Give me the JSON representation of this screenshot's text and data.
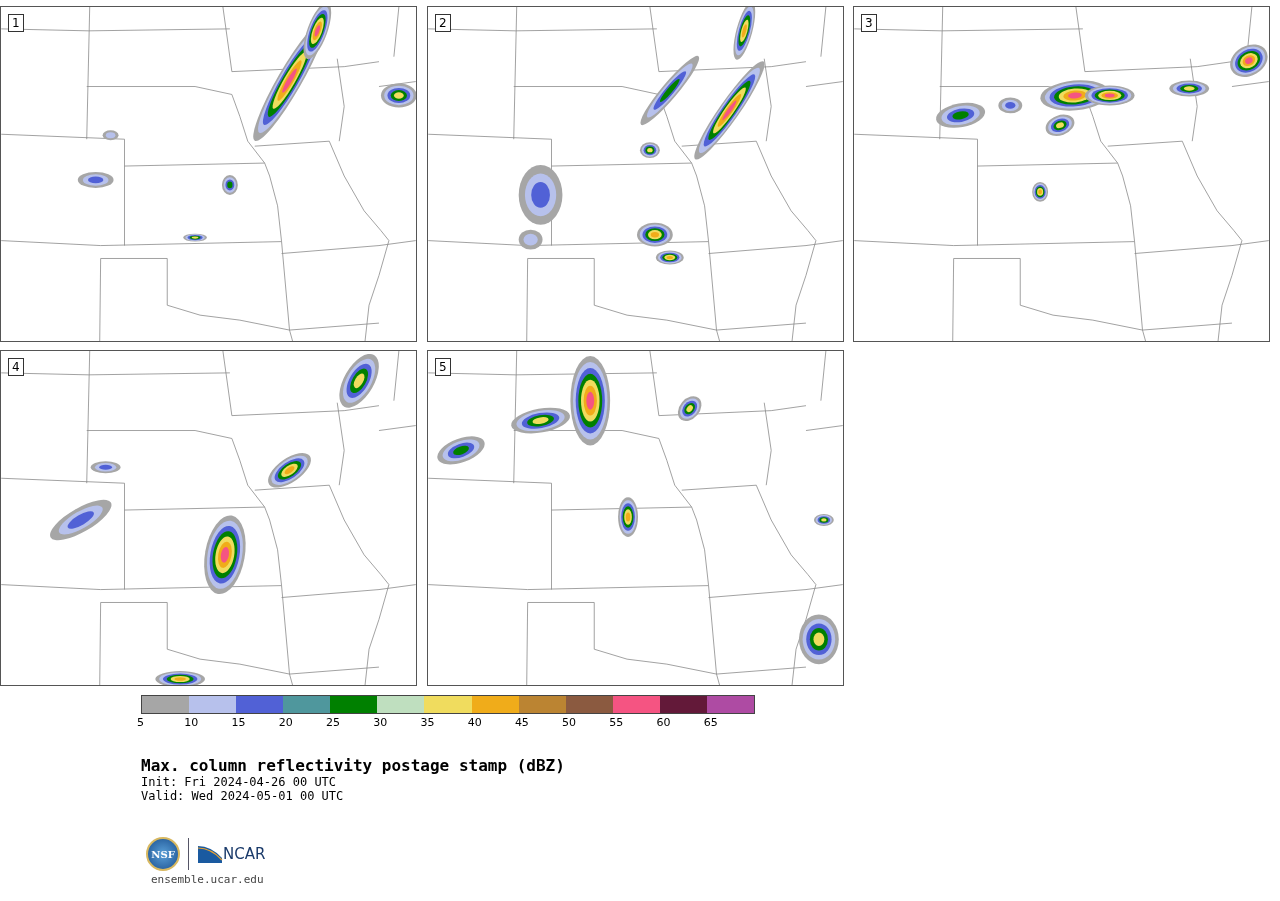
{
  "panels": [
    {
      "label": "1"
    },
    {
      "label": "2"
    },
    {
      "label": "3"
    },
    {
      "label": "4"
    },
    {
      "label": "5"
    }
  ],
  "colorbar": {
    "bins": [
      {
        "color": "#a6a6a6",
        "tick": "5"
      },
      {
        "color": "#b7c1ec",
        "tick": "10"
      },
      {
        "color": "#5161d6",
        "tick": "15"
      },
      {
        "color": "#4f979d",
        "tick": "20"
      },
      {
        "color": "#008000",
        "tick": "25"
      },
      {
        "color": "#bfdfbf",
        "tick": "30"
      },
      {
        "color": "#f0dc5e",
        "tick": "35"
      },
      {
        "color": "#f0ac1a",
        "tick": "40"
      },
      {
        "color": "#bb8432",
        "tick": "45"
      },
      {
        "color": "#8b5a40",
        "tick": "50"
      },
      {
        "color": "#f55482",
        "tick": "55"
      },
      {
        "color": "#631939",
        "tick": "60"
      },
      {
        "color": "#ae4ba3",
        "tick": "65"
      }
    ]
  },
  "title": "Max. column reflectivity postage stamp (dBZ)",
  "init": " Init: Fri 2024-04-26 00 UTC",
  "valid": "Valid: Wed 2024-05-01 00 UTC",
  "logo": {
    "nsf": "NSF",
    "ncar": "NCAR"
  },
  "url": "ensemble.ucar.edu"
}
